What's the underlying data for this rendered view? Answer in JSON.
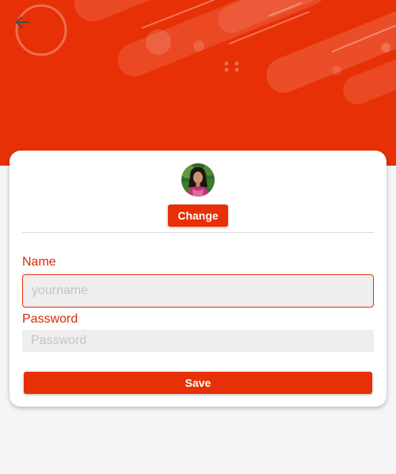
{
  "colors": {
    "accent": "#e73005",
    "label": "#d42e0a",
    "background": "#f4f5f7",
    "card": "#ffffff"
  },
  "header": {
    "back_icon": "arrow-left-icon"
  },
  "profile": {
    "avatar": "avatar-photo",
    "change_label": "Change"
  },
  "form": {
    "name_label": "Name",
    "name_placeholder": "yourname",
    "password_label": "Password",
    "password_placeholder": "Password",
    "save_label": "Save"
  }
}
